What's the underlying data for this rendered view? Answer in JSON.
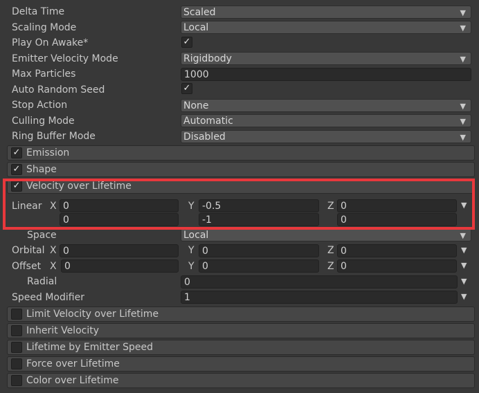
{
  "main_props": [
    {
      "label": "Delta Time",
      "type": "dropdown",
      "value": "Scaled"
    },
    {
      "label": "Scaling Mode",
      "type": "dropdown",
      "value": "Local"
    },
    {
      "label": "Play On Awake*",
      "type": "toggle",
      "value": "✓"
    },
    {
      "label": "Emitter Velocity Mode",
      "type": "dropdown",
      "value": "Rigidbody"
    },
    {
      "label": "Max Particles",
      "type": "field",
      "value": "1000"
    },
    {
      "label": "Auto Random Seed",
      "type": "toggle",
      "value": "✓"
    },
    {
      "label": "Stop Action",
      "type": "dropdown",
      "value": "None"
    },
    {
      "label": "Culling Mode",
      "type": "dropdown",
      "value": "Automatic"
    },
    {
      "label": "Ring Buffer Mode",
      "type": "dropdown",
      "value": "Disabled"
    }
  ],
  "modules_top": [
    {
      "label": "Emission",
      "check": "✓"
    },
    {
      "label": "Shape",
      "check": "✓"
    },
    {
      "label": "Velocity over Lifetime",
      "check": "✓"
    }
  ],
  "velocity": {
    "linear_label": "Linear",
    "axis_x": "X",
    "axis_y": "Y",
    "axis_z": "Z",
    "linear_max": {
      "x": "0",
      "y": "-0.5",
      "z": "0"
    },
    "linear_min": {
      "x": "0",
      "y": "-1",
      "z": "0"
    },
    "space_label": "Space",
    "space_value": "Local",
    "orbital_label": "Orbital",
    "orbital": {
      "x": "0",
      "y": "0",
      "z": "0"
    },
    "offset_label": "Offset",
    "offset": {
      "x": "0",
      "y": "0",
      "z": "0"
    },
    "radial_label": "Radial",
    "radial_value": "0",
    "speed_label": "Speed Modifier",
    "speed_value": "1"
  },
  "modules_bottom": [
    {
      "label": "Limit Velocity over Lifetime",
      "check": ""
    },
    {
      "label": "Inherit Velocity",
      "check": ""
    },
    {
      "label": "Lifetime by Emitter Speed",
      "check": ""
    },
    {
      "label": "Force over Lifetime",
      "check": ""
    },
    {
      "label": "Color over Lifetime",
      "check": ""
    }
  ],
  "dropdown_arrow": "▼",
  "colors": {
    "background": "#383838",
    "highlight": "#e8383c",
    "field": "#2a2a2a"
  }
}
